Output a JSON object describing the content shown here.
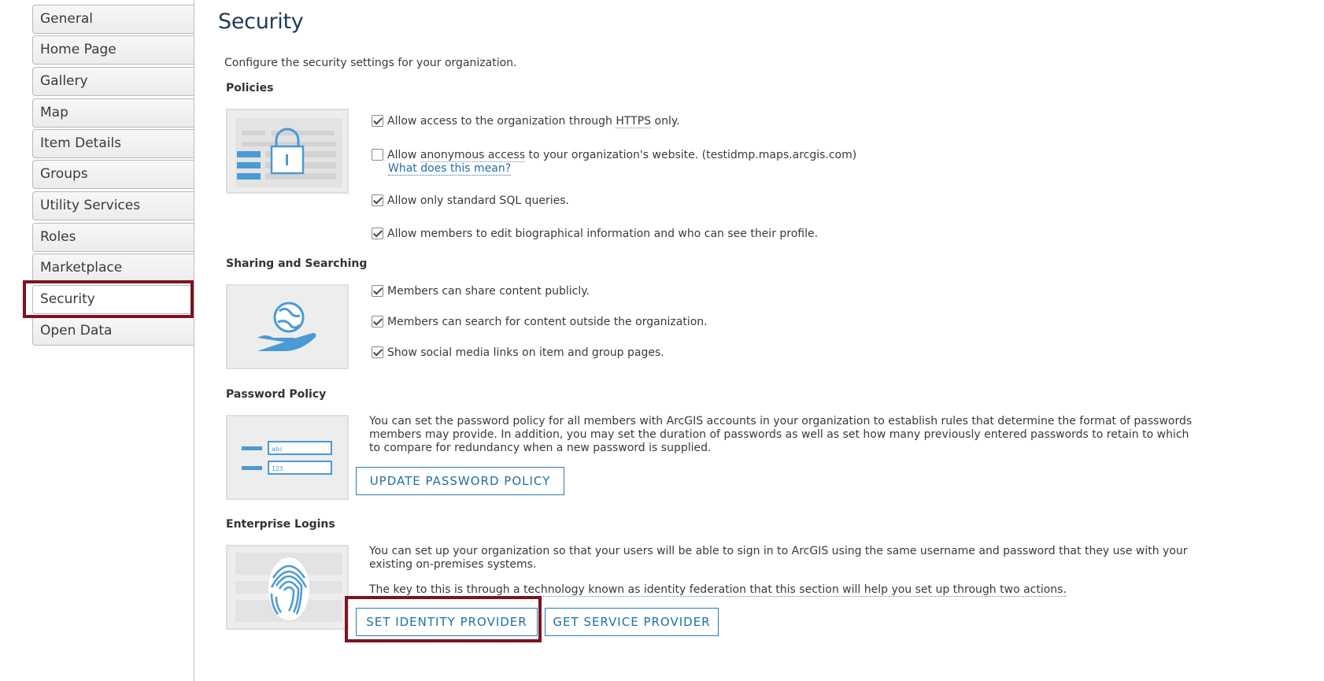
{
  "sidebar": {
    "items": [
      {
        "label": "General"
      },
      {
        "label": "Home Page"
      },
      {
        "label": "Gallery"
      },
      {
        "label": "Map"
      },
      {
        "label": "Item Details"
      },
      {
        "label": "Groups"
      },
      {
        "label": "Utility Services"
      },
      {
        "label": "Roles"
      },
      {
        "label": "Marketplace"
      },
      {
        "label": "Security"
      },
      {
        "label": "Open Data"
      }
    ],
    "active": "Security"
  },
  "main": {
    "title": "Security",
    "intro": "Configure the security settings for your organization.",
    "policies": {
      "heading": "Policies",
      "https": {
        "checked": true,
        "pre": "Allow access to the organization through ",
        "link": "HTTPS",
        "post": " only."
      },
      "anonymous": {
        "checked": false,
        "pre": "Allow ",
        "link": "anonymous access",
        "post": " to your organization's website. (testidmp.maps.arcgis.com)",
        "help": "What does this mean?"
      },
      "sql": {
        "checked": true,
        "label": "Allow only standard SQL queries."
      },
      "bio": {
        "checked": true,
        "label": "Allow members to edit biographical information and who can see their profile."
      }
    },
    "sharing": {
      "heading": "Sharing and Searching",
      "share_public": {
        "checked": true,
        "label": "Members can share content publicly."
      },
      "search_outside": {
        "checked": true,
        "label": "Members can search for content outside the organization."
      },
      "social_links": {
        "checked": true,
        "label": "Show social media links on item and group pages."
      }
    },
    "password": {
      "heading": "Password Policy",
      "description": "You can set the password policy for all members with ArcGIS accounts in your organization to establish rules that determine the format of passwords members may provide. In addition, you may set the duration of passwords as well as set how many previously entered passwords to retain to which to compare for redundancy when a new password is supplied.",
      "button": "UPDATE PASSWORD POLICY",
      "illus_field1": "abc",
      "illus_field2": "123"
    },
    "enterprise": {
      "heading": "Enterprise Logins",
      "description": "You can set up your organization so that your users will be able to sign in to ArcGIS using the same username and password that they use with your existing on-premises systems.",
      "note": "The key to this is through a technology known as identity federation that this section will help you set up through two actions.",
      "button_identity": "SET IDENTITY PROVIDER",
      "button_service": "GET SERVICE PROVIDER"
    }
  },
  "colors": {
    "highlight": "#7a1520",
    "link": "#1f6fa8",
    "title": "#1d3a5c",
    "illustration_blue": "#4a9ad4"
  }
}
